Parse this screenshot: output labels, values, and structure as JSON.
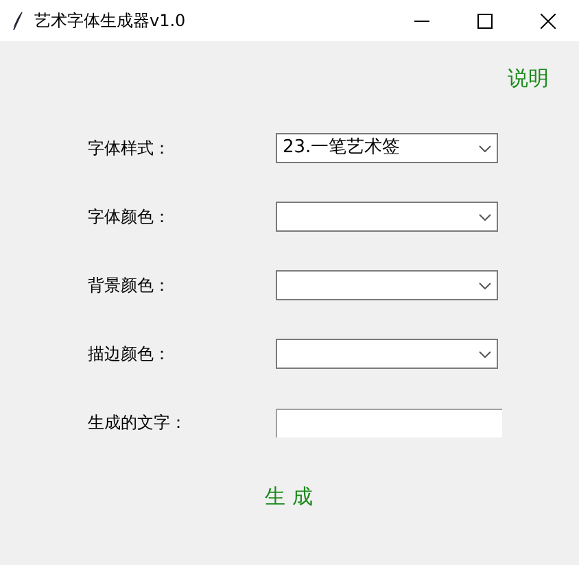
{
  "window": {
    "title": "艺术字体生成器v1.0"
  },
  "help_link": "说明",
  "fields": [
    {
      "kind": "combo",
      "label": "字体样式：",
      "value": "23.一笔艺术签"
    },
    {
      "kind": "combo",
      "label": "字体颜色："
    },
    {
      "kind": "combo",
      "label": "背景颜色："
    },
    {
      "kind": "combo",
      "label": "描边颜色："
    },
    {
      "kind": "entry",
      "label": "生成的文字："
    }
  ],
  "generate_button": "生 成"
}
